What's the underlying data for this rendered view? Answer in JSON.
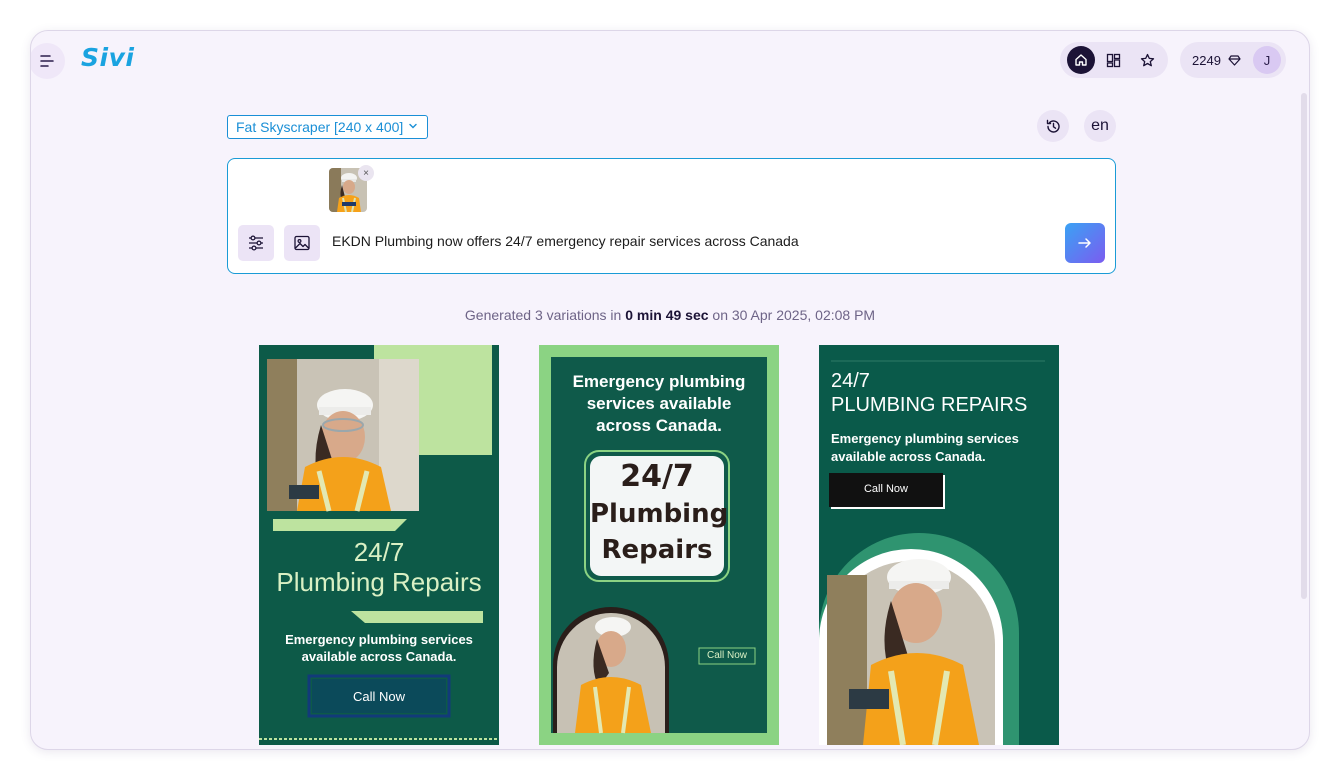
{
  "app": {
    "logo": "Sivi"
  },
  "header": {
    "credits": "2249",
    "avatar_initial": "J"
  },
  "toolbar": {
    "size_selected": "Fat Skyscraper [240 x 400]",
    "language": "en"
  },
  "prompt": {
    "text": "EKDN Plumbing now offers 24/7 emergency repair services across Canada"
  },
  "status": {
    "prefix": "Generated 3 variations in",
    "duration": "0 min 49 sec",
    "suffix": "on 30 Apr 2025, 02:08 PM"
  },
  "ads": [
    {
      "headline_a": "24/7",
      "headline_b": "Plumbing Repairs",
      "body": "Emergency plumbing services available across Canada.",
      "cta": "Call Now"
    },
    {
      "body": "Emergency plumbing services available across Canada.",
      "headline_a": "24/7",
      "headline_b": "Plumbing",
      "headline_c": "Repairs",
      "cta": "Call Now"
    },
    {
      "headline_a": "24/7",
      "headline_b": "PLUMBING REPAIRS",
      "body": "Emergency plumbing services available across Canada.",
      "cta": "Call Now"
    }
  ],
  "colors": {
    "accent": "#1a8fd6",
    "ad_green": "#0d5a48",
    "ad_lime": "#bde39f",
    "send_gradient": [
      "#3aa2f4",
      "#7b5cf0"
    ]
  },
  "icons": [
    "menu-icon",
    "home-icon",
    "grid-icon",
    "star-icon",
    "gem-icon",
    "history-icon",
    "sliders-icon",
    "image-icon",
    "arrow-right-icon",
    "chevron-down-icon",
    "close-icon"
  ]
}
